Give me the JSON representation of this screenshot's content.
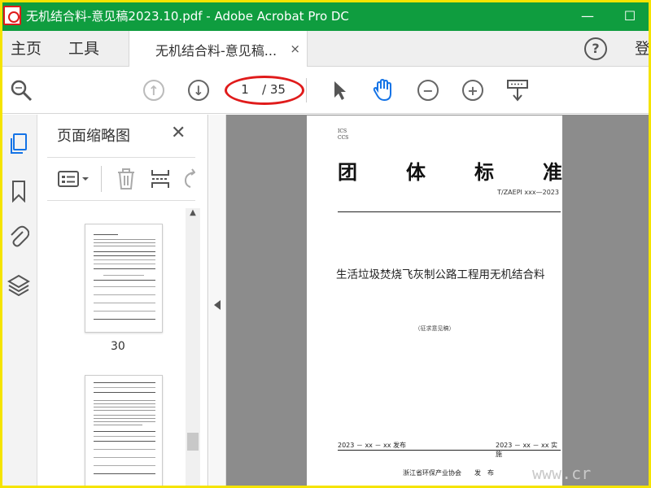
{
  "window": {
    "title": "无机结合料-意见稿2023.10.pdf - Adobe Acrobat Pro DC",
    "minimize": "—",
    "maximize": "☐"
  },
  "menu": {
    "home": "主页",
    "tools": "工具",
    "tab_label": "无机结合料-意见稿...",
    "tab_close": "×",
    "login": "登"
  },
  "toolbar": {
    "page_current": "1",
    "page_total": "/ 35"
  },
  "thumbnails": {
    "title": "页面缩略图",
    "close": "✕",
    "page_label": "30"
  },
  "document": {
    "ics": "ICS",
    "ccs": "CCS",
    "heading_chars": [
      "团",
      "体",
      "标",
      "准"
    ],
    "code": "T/ZAEPI xxx—2023",
    "title": "生活垃圾焚烧飞灰制公路工程用无机结合料",
    "draft": "（征求意见稿）",
    "release_date": "2023 － xx － xx 发布",
    "implement_date": "2023 － xx － xx 实施",
    "publisher": "浙江省环保产业协会　　发　布"
  },
  "watermark": "www.cr",
  "colors": {
    "titlebar": "#0f9d3f",
    "frame": "#f5e400",
    "highlight": "#e01b1b",
    "hand_tool": "#1473e6",
    "rail_active": "#1473e6"
  }
}
